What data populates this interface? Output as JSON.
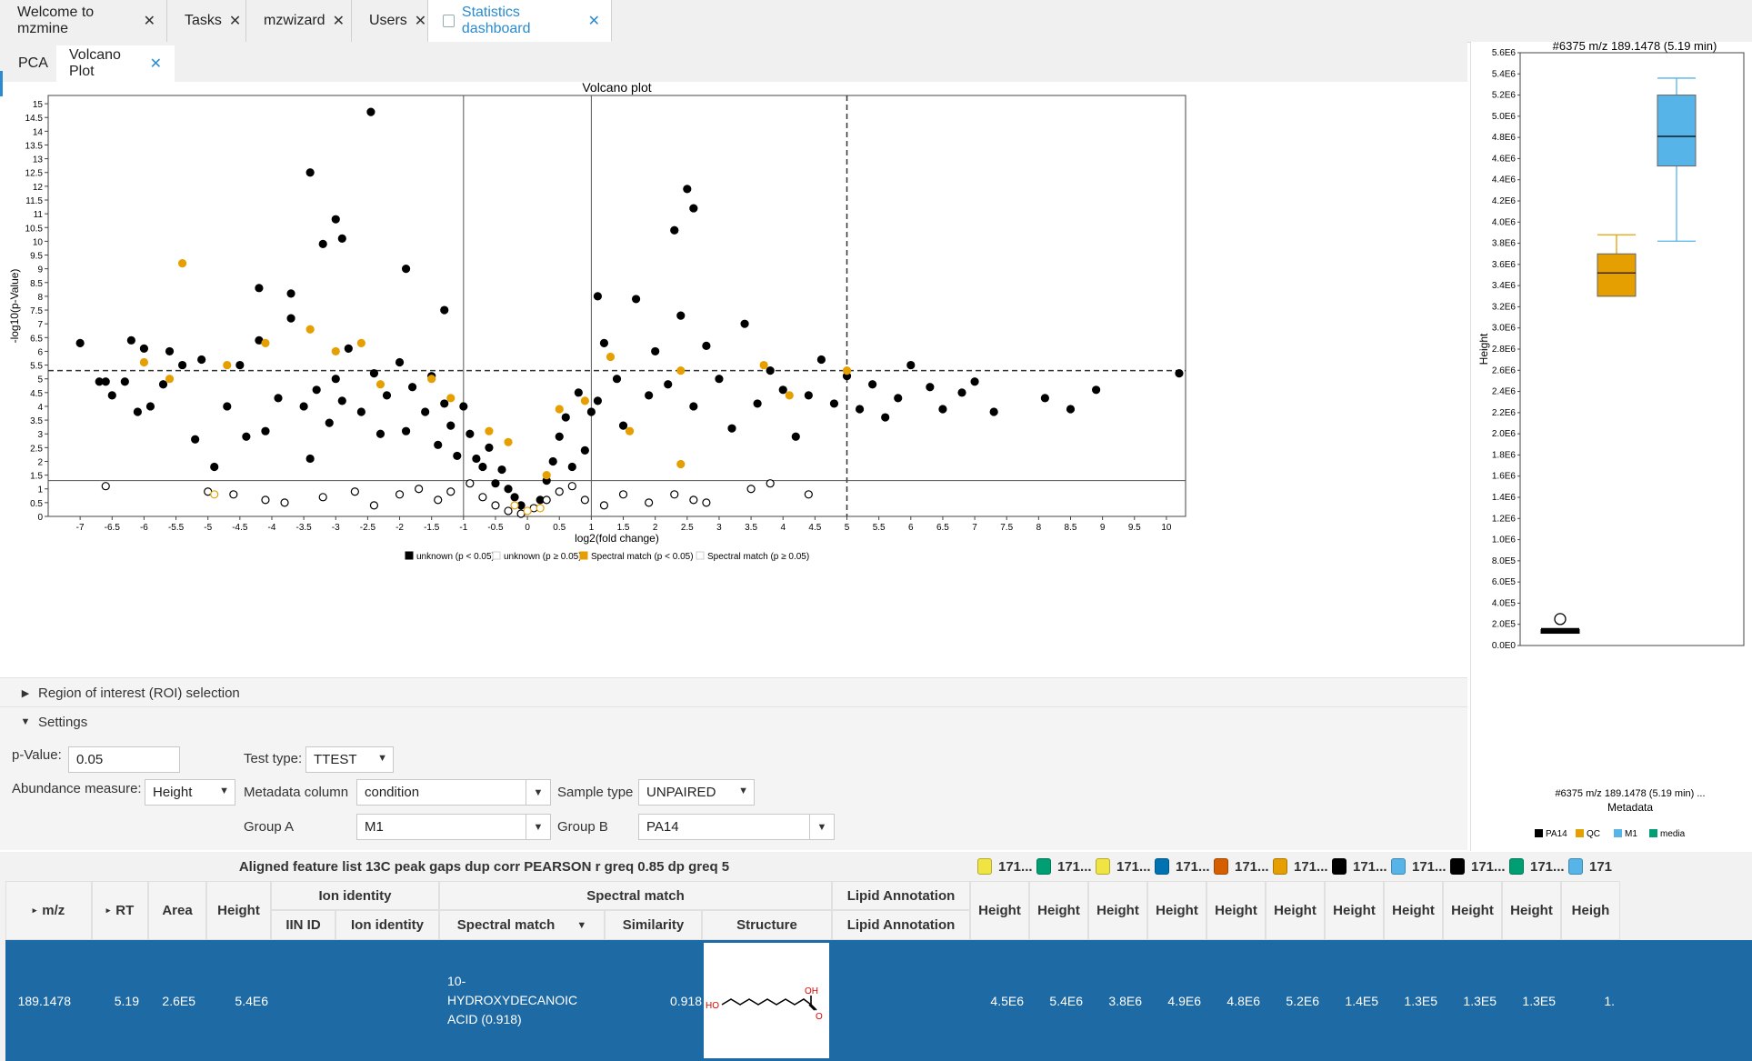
{
  "top_tabs": [
    {
      "label": "Welcome to mzmine"
    },
    {
      "label": "Tasks"
    },
    {
      "label": "mzwizard"
    },
    {
      "label": "Users"
    },
    {
      "label": "Statistics dashboard"
    }
  ],
  "close_glyph": "✕",
  "sub_tabs": [
    {
      "label": "PCA"
    },
    {
      "label": "Volcano Plot"
    }
  ],
  "volcano": {
    "title": "Volcano plot",
    "xlabel": "log2(fold change)",
    "ylabel": "-log10(p-Value)",
    "legend": [
      "unknown (p < 0.05)",
      "unknown (p ≥ 0.05)",
      "Spectral match (p < 0.05)",
      "Spectral match (p ≥ 0.05)"
    ],
    "colors": {
      "unknown": "#000000",
      "spectral": "#e69f00"
    }
  },
  "chart_data": [
    {
      "type": "scatter",
      "title": "Volcano plot",
      "xlabel": "log2(fold change)",
      "ylabel": "-log10(p-Value)",
      "xlim": [
        -7.5,
        10.3
      ],
      "ylim": [
        0,
        15.3
      ],
      "xticks": [
        -7,
        -6.5,
        -6,
        -5.5,
        -5,
        -4.5,
        -4,
        -3.5,
        -3,
        -2.5,
        -2,
        -1.5,
        -1,
        -0.5,
        0,
        0.5,
        1,
        1.5,
        2,
        2.5,
        3,
        3.5,
        4,
        4.5,
        5,
        5.5,
        6,
        6.5,
        7,
        7.5,
        8,
        8.5,
        9,
        9.5,
        10
      ],
      "yticks": [
        0,
        0.5,
        1,
        1.5,
        2,
        2.5,
        3,
        3.5,
        4,
        4.5,
        5,
        5.5,
        6,
        6.5,
        7,
        7.5,
        8,
        8.5,
        9,
        9.5,
        10,
        10.5,
        11,
        11.5,
        12,
        12.5,
        13,
        13.5,
        14,
        14.5,
        15
      ],
      "thresholds": {
        "vlines_solid": [
          -1,
          1
        ],
        "vline_dashed": 5,
        "hline_solid": 1.3,
        "hline_dashed": 5.3
      },
      "series": [
        {
          "name": "unknown (p < 0.05)",
          "x": [
            -7.0,
            -6.7,
            -6.5,
            -6.3,
            -6.2,
            -6.1,
            -6.0,
            -5.9,
            -5.7,
            -5.6,
            -5.4,
            -5.2,
            -5.1,
            -4.9,
            -4.7,
            -4.5,
            -4.4,
            -4.2,
            -4.1,
            -3.9,
            -3.7,
            -3.5,
            -3.4,
            -3.3,
            -3.1,
            -3.0,
            -2.9,
            -2.8,
            -2.6,
            -2.4,
            -2.3,
            -2.2,
            -2.0,
            -1.9,
            -1.8,
            -1.6,
            -1.5,
            -1.4,
            -1.3,
            -1.2,
            -1.1,
            -1.0,
            -0.9,
            -0.8,
            -0.7,
            -0.6,
            -0.5,
            -0.4,
            -0.3,
            -0.2,
            -0.1,
            0.2,
            0.3,
            0.4,
            0.5,
            0.6,
            0.7,
            0.8,
            0.9,
            1.0,
            1.1,
            1.2,
            1.4,
            1.5,
            1.7,
            1.9,
            2.0,
            2.2,
            2.4,
            2.6,
            2.8,
            3.0,
            3.2,
            3.4,
            3.6,
            3.8,
            4.0,
            4.2,
            4.4,
            4.6,
            4.8,
            5.0,
            5.2,
            5.4,
            5.6,
            5.8,
            6.0,
            6.3,
            6.5,
            6.8,
            7.0,
            7.3,
            8.1,
            8.5,
            8.9,
            10.2,
            -2.45,
            -3.4,
            -3.0,
            -2.9,
            -3.2,
            -1.9,
            2.5,
            2.6,
            2.3,
            -4.2,
            -3.7,
            1.1,
            -6.6,
            -1.3
          ],
          "y": [
            6.3,
            4.9,
            4.4,
            4.9,
            6.4,
            3.8,
            6.1,
            4.0,
            4.8,
            6.0,
            5.5,
            2.8,
            5.7,
            1.8,
            4.0,
            5.5,
            2.9,
            6.4,
            3.1,
            4.3,
            7.2,
            4.0,
            2.1,
            4.6,
            3.4,
            5.0,
            4.2,
            6.1,
            3.8,
            5.2,
            3.0,
            4.4,
            5.6,
            3.1,
            4.7,
            3.8,
            5.1,
            2.6,
            4.1,
            3.3,
            2.2,
            4.0,
            3.0,
            2.1,
            1.8,
            2.5,
            1.2,
            1.7,
            1.0,
            0.7,
            0.4,
            0.6,
            1.3,
            2.0,
            2.9,
            3.6,
            1.8,
            4.5,
            2.4,
            3.8,
            4.2,
            6.3,
            5.0,
            3.3,
            7.9,
            4.4,
            6.0,
            4.8,
            7.3,
            4.0,
            6.2,
            5.0,
            3.2,
            7.0,
            4.1,
            5.3,
            4.6,
            2.9,
            4.4,
            5.7,
            4.1,
            5.1,
            3.9,
            4.8,
            3.6,
            4.3,
            5.5,
            4.7,
            3.9,
            4.5,
            4.9,
            3.8,
            4.3,
            3.9,
            4.6,
            5.2,
            14.7,
            12.5,
            10.8,
            10.1,
            9.9,
            9.0,
            11.9,
            11.2,
            10.4,
            8.3,
            8.1,
            8.0,
            4.9,
            7.5
          ]
        },
        {
          "name": "unknown (p ≥ 0.05)",
          "x": [
            -6.6,
            -5.0,
            -4.6,
            -4.1,
            -3.8,
            -3.2,
            -2.7,
            -2.4,
            -2.0,
            -1.7,
            -1.4,
            -1.2,
            -0.9,
            -0.7,
            -0.5,
            -0.3,
            -0.1,
            0.1,
            0.3,
            0.5,
            0.7,
            0.9,
            1.2,
            1.5,
            1.9,
            2.3,
            2.6,
            2.8,
            3.5,
            3.8,
            4.4
          ],
          "y": [
            1.1,
            0.9,
            0.8,
            0.6,
            0.5,
            0.7,
            0.9,
            0.4,
            0.8,
            1.0,
            0.6,
            0.9,
            1.2,
            0.7,
            0.4,
            0.2,
            0.1,
            0.3,
            0.6,
            0.9,
            1.1,
            0.6,
            0.4,
            0.8,
            0.5,
            0.8,
            0.6,
            0.5,
            1.0,
            1.2,
            0.8
          ]
        },
        {
          "name": "Spectral match (p < 0.05)",
          "x": [
            -5.4,
            -6.0,
            -5.6,
            -4.7,
            -4.1,
            -3.4,
            -3.0,
            -2.6,
            -2.3,
            -1.5,
            -1.2,
            -0.6,
            -0.3,
            0.3,
            0.5,
            0.9,
            1.3,
            1.6,
            2.4,
            2.4,
            3.7,
            4.1,
            5.0
          ],
          "y": [
            9.2,
            5.6,
            5.0,
            5.5,
            6.3,
            6.8,
            6.0,
            6.3,
            4.8,
            5.0,
            4.3,
            3.1,
            2.7,
            1.5,
            3.9,
            4.2,
            5.8,
            3.1,
            5.3,
            1.9,
            5.5,
            4.4,
            5.3
          ]
        },
        {
          "name": "Spectral match (p ≥ 0.05)",
          "x": [
            -4.9,
            -0.2,
            0.0,
            0.2
          ],
          "y": [
            0.8,
            0.4,
            0.2,
            0.3
          ]
        }
      ]
    },
    {
      "type": "box",
      "title": "#6375 m/z 189.1478 (5.19 min)",
      "xlabel": "Metadata",
      "ylabel": "Height",
      "category_label": "#6375 m/z 189.1478 (5.19 min) ...",
      "ylim": [
        0,
        5600000
      ],
      "yticks": [
        "0.0E0",
        "2.0E5",
        "4.0E5",
        "6.0E5",
        "8.0E5",
        "1.0E6",
        "1.2E6",
        "1.4E6",
        "1.6E6",
        "1.8E6",
        "2.0E6",
        "2.2E6",
        "2.4E6",
        "2.6E6",
        "2.8E6",
        "3.0E6",
        "3.2E6",
        "3.4E6",
        "3.6E6",
        "3.8E6",
        "4.0E6",
        "4.2E6",
        "4.4E6",
        "4.6E6",
        "4.8E6",
        "5.0E6",
        "5.2E6",
        "5.4E6",
        "5.6E6"
      ],
      "legend": [
        {
          "name": "PA14",
          "color": "#000000"
        },
        {
          "name": "QC",
          "color": "#e69f00"
        },
        {
          "name": "M1",
          "color": "#56b4e9"
        },
        {
          "name": "media",
          "color": "#009e73"
        }
      ],
      "boxes": [
        {
          "name": "PA14",
          "color": "#000000",
          "min": 130000,
          "q1": 130000,
          "median": 140000,
          "q3": 150000,
          "max": 160000,
          "outliers": [
            250000
          ]
        },
        {
          "name": "QC",
          "color": "#e69f00",
          "min": 3300000,
          "q1": 3300000,
          "median": 3520000,
          "q3": 3700000,
          "max": 3880000,
          "outliers": []
        },
        {
          "name": "M1",
          "color": "#56b4e9",
          "min": 3820000,
          "q1": 4530000,
          "median": 4810000,
          "q3": 5200000,
          "max": 5360000,
          "outliers": []
        }
      ]
    }
  ],
  "sections": {
    "roi": "Region of interest (ROI) selection",
    "settings": "Settings"
  },
  "settings": {
    "pvalue_label": "p-Value:",
    "pvalue": "0.05",
    "test_type_label": "Test type:",
    "test_type": "TTEST",
    "abundance_label": "Abundance measure:",
    "abundance": "Height",
    "metadata_label": "Metadata column",
    "metadata": "condition",
    "sample_type_label": "Sample type",
    "sample_type": "UNPAIRED",
    "group_a_label": "Group A",
    "group_a": "M1",
    "group_b_label": "Group B",
    "group_b": "PA14"
  },
  "table": {
    "title": "Aligned feature list 13C peak gaps dup corr PEARSON r greq 0.85 dp greq 5",
    "sample_groups": [
      {
        "label": "171...",
        "color": "#f0e442"
      },
      {
        "label": "171...",
        "color": "#009e73"
      },
      {
        "label": "171...",
        "color": "#f0e442"
      },
      {
        "label": "171...",
        "color": "#0072b2"
      },
      {
        "label": "171...",
        "color": "#d55e00"
      },
      {
        "label": "171...",
        "color": "#e69f00"
      },
      {
        "label": "171...",
        "color": "#000000"
      },
      {
        "label": "171...",
        "color": "#56b4e9"
      },
      {
        "label": "171...",
        "color": "#000000"
      },
      {
        "label": "171...",
        "color": "#009e73"
      },
      {
        "label": "171",
        "color": "#56b4e9"
      }
    ],
    "headers": {
      "mz": "m/z",
      "rt": "RT",
      "area": "Area",
      "height": "Height",
      "ion_identity": "Ion identity",
      "iin_id": "IIN ID",
      "ion_identity_sub": "Ion identity",
      "spectral_match": "Spectral match",
      "spectral_match_sub": "Spectral match",
      "similarity": "Similarity",
      "structure": "Structure",
      "lipid": "Lipid Annotation",
      "lipid_sub": "Lipid Annotation",
      "sample_height": "Height",
      "last_height": "Heigh"
    },
    "row": {
      "mz": "189.1478",
      "rt": "5.19",
      "area": "2.6E5",
      "height": "5.4E6",
      "match_name": "10-HYDROXYDECANOIC ACID (0.918)",
      "similarity": "0.918",
      "mol_ho": "HO",
      "mol_oh": "OH",
      "mol_o": "O",
      "heights": [
        "4.5E6",
        "5.4E6",
        "3.8E6",
        "4.9E6",
        "4.8E6",
        "5.2E6",
        "1.4E5",
        "1.3E5",
        "1.3E5",
        "1.3E5",
        "1."
      ]
    }
  }
}
